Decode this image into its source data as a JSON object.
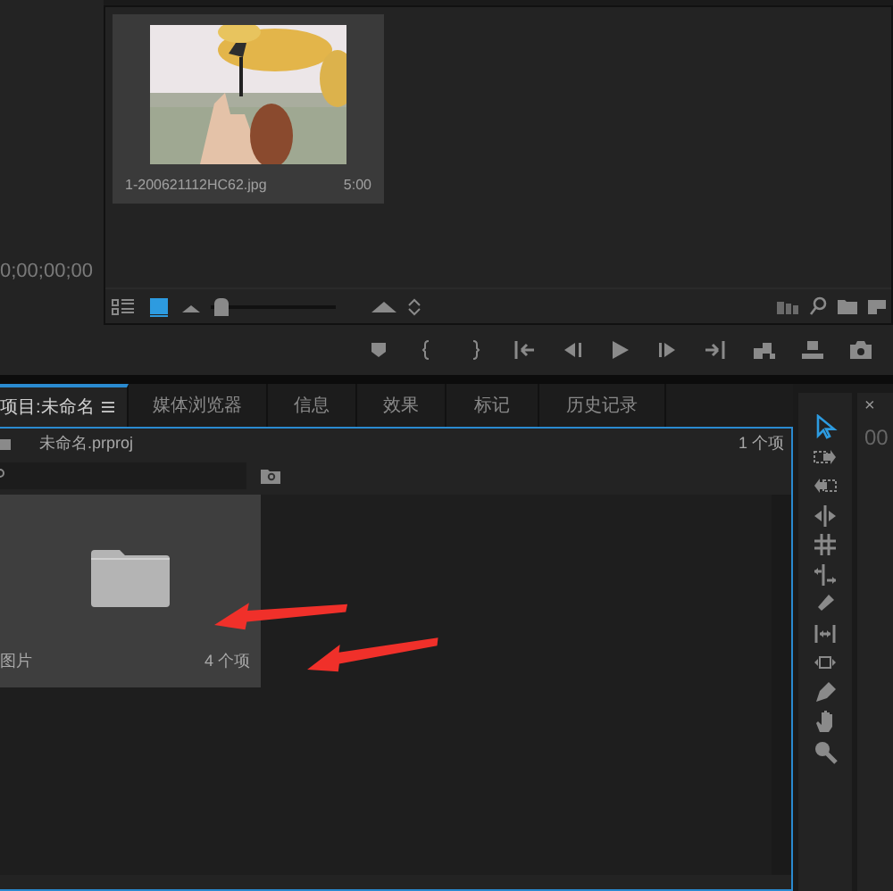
{
  "left_monitor": {
    "timecode": "0;00;00;00"
  },
  "source_bin": {
    "items": [
      {
        "name": "1-200621112HC62.jpg",
        "duration": "5:00",
        "kind": "picture"
      }
    ],
    "view_modes": [
      {
        "kind": "list",
        "selected": false
      },
      {
        "kind": "icon",
        "selected": true
      }
    ],
    "zoom": {
      "level": 0.03
    }
  },
  "transport": [
    {
      "kind": "marker"
    },
    {
      "kind": "in"
    },
    {
      "kind": "out"
    },
    {
      "kind": "goto-in"
    },
    {
      "kind": "step-back"
    },
    {
      "kind": "play"
    },
    {
      "kind": "step-forward"
    },
    {
      "kind": "goto-out"
    },
    {
      "kind": "insert"
    },
    {
      "kind": "overwrite"
    },
    {
      "kind": "camera"
    }
  ],
  "project_panel": {
    "tabs": [
      {
        "label": "项目:未命名",
        "selected": true
      },
      {
        "label": "媒体浏览器",
        "selected": false
      },
      {
        "label": "信息",
        "selected": false
      },
      {
        "label": "效果",
        "selected": false
      },
      {
        "label": "标记",
        "selected": false
      },
      {
        "label": "历史记录",
        "selected": false
      }
    ],
    "file": "未命名.prproj",
    "item_count": "1 个项",
    "bins": [
      {
        "name": "图片",
        "count": "4 个项"
      }
    ]
  },
  "tools": [
    {
      "kind": "select",
      "selected": true
    },
    {
      "kind": "track-forward",
      "selected": false
    },
    {
      "kind": "track-back",
      "selected": false
    },
    {
      "kind": "ripple",
      "selected": false
    },
    {
      "kind": "rolling",
      "selected": false
    },
    {
      "kind": "rate",
      "selected": false
    },
    {
      "kind": "razor",
      "selected": false
    },
    {
      "kind": "slip",
      "selected": false
    },
    {
      "kind": "slide",
      "selected": false
    },
    {
      "kind": "pen",
      "selected": false
    },
    {
      "kind": "hand",
      "selected": false
    },
    {
      "kind": "zoom",
      "selected": false
    }
  ],
  "right_panel": {
    "close": "×",
    "timecode": "00"
  },
  "annotations": [
    {
      "kind": "arrow"
    },
    {
      "kind": "arrow"
    }
  ]
}
